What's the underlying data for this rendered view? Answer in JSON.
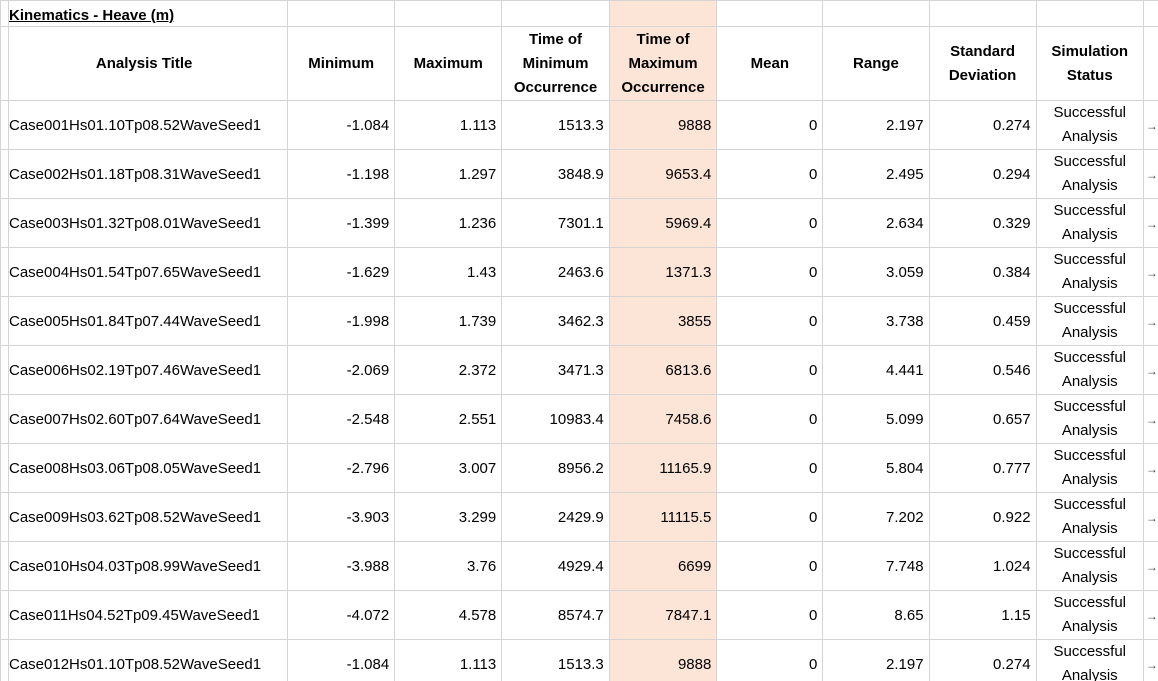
{
  "sheet": {
    "title": "Kinematics - Heave (m)",
    "headers": {
      "analysis_title": "Analysis Title",
      "minimum": "Minimum",
      "maximum": "Maximum",
      "time_min": "Time of Minimum Occurrence",
      "time_max": "Time of Maximum Occurrence",
      "mean": "Mean",
      "range": "Range",
      "std_dev": "Standard Deviation",
      "sim_status": "Simulation Status"
    },
    "highlight_color": "#fce4d6",
    "rows": [
      {
        "title": "Case001Hs01.10Tp08.52WaveSeed1",
        "min": "-1.084",
        "max": "1.113",
        "tmin": "1513.3",
        "tmax": "9888",
        "mean": "0",
        "range": "2.197",
        "std": "0.274",
        "status": "Successful Analysis"
      },
      {
        "title": "Case002Hs01.18Tp08.31WaveSeed1",
        "min": "-1.198",
        "max": "1.297",
        "tmin": "3848.9",
        "tmax": "9653.4",
        "mean": "0",
        "range": "2.495",
        "std": "0.294",
        "status": "Successful Analysis"
      },
      {
        "title": "Case003Hs01.32Tp08.01WaveSeed1",
        "min": "-1.399",
        "max": "1.236",
        "tmin": "7301.1",
        "tmax": "5969.4",
        "mean": "0",
        "range": "2.634",
        "std": "0.329",
        "status": "Successful Analysis"
      },
      {
        "title": "Case004Hs01.54Tp07.65WaveSeed1",
        "min": "-1.629",
        "max": "1.43",
        "tmin": "2463.6",
        "tmax": "1371.3",
        "mean": "0",
        "range": "3.059",
        "std": "0.384",
        "status": "Successful Analysis"
      },
      {
        "title": "Case005Hs01.84Tp07.44WaveSeed1",
        "min": "-1.998",
        "max": "1.739",
        "tmin": "3462.3",
        "tmax": "3855",
        "mean": "0",
        "range": "3.738",
        "std": "0.459",
        "status": "Successful Analysis"
      },
      {
        "title": "Case006Hs02.19Tp07.46WaveSeed1",
        "min": "-2.069",
        "max": "2.372",
        "tmin": "3471.3",
        "tmax": "6813.6",
        "mean": "0",
        "range": "4.441",
        "std": "0.546",
        "status": "Successful Analysis"
      },
      {
        "title": "Case007Hs02.60Tp07.64WaveSeed1",
        "min": "-2.548",
        "max": "2.551",
        "tmin": "10983.4",
        "tmax": "7458.6",
        "mean": "0",
        "range": "5.099",
        "std": "0.657",
        "status": "Successful Analysis"
      },
      {
        "title": "Case008Hs03.06Tp08.05WaveSeed1",
        "min": "-2.796",
        "max": "3.007",
        "tmin": "8956.2",
        "tmax": "11165.9",
        "mean": "0",
        "range": "5.804",
        "std": "0.777",
        "status": "Successful Analysis"
      },
      {
        "title": "Case009Hs03.62Tp08.52WaveSeed1",
        "min": "-3.903",
        "max": "3.299",
        "tmin": "2429.9",
        "tmax": "11115.5",
        "mean": "0",
        "range": "7.202",
        "std": "0.922",
        "status": "Successful Analysis"
      },
      {
        "title": "Case010Hs04.03Tp08.99WaveSeed1",
        "min": "-3.988",
        "max": "3.76",
        "tmin": "4929.4",
        "tmax": "6699",
        "mean": "0",
        "range": "7.748",
        "std": "1.024",
        "status": "Successful Analysis"
      },
      {
        "title": "Case011Hs04.52Tp09.45WaveSeed1",
        "min": "-4.072",
        "max": "4.578",
        "tmin": "8574.7",
        "tmax": "7847.1",
        "mean": "0",
        "range": "8.65",
        "std": "1.15",
        "status": "Successful Analysis"
      },
      {
        "title": "Case012Hs01.10Tp08.52WaveSeed1",
        "min": "-1.084",
        "max": "1.113",
        "tmin": "1513.3",
        "tmax": "9888",
        "mean": "0",
        "range": "2.197",
        "std": "0.274",
        "status": "Successful Analysis"
      }
    ],
    "edge_mark": "→"
  }
}
